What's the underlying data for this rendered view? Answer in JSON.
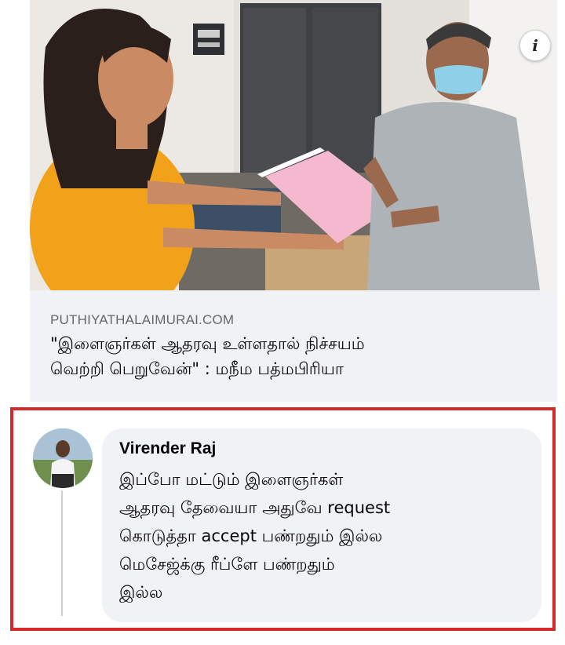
{
  "post": {
    "image_alt": "",
    "info_icon": "info-icon",
    "info_glyph": "i",
    "link_source": "PUTHIYATHALAIMURAI.COM",
    "headline_line1": "\"இளைஞர்கள் ஆதரவு உள்ளதால் நிச்சயம்",
    "headline_line2": "வெற்றி பெறுவேன்\" : மநீம பத்மபிரியா"
  },
  "comment": {
    "author": "Virender Raj",
    "lines": [
      "இப்போ மட்டும் இளைஞர்கள்",
      "ஆதரவு தேவையா அதுவே request",
      "கொடுத்தா accept பண்றதும் இல்ல",
      "மெசேஜ்க்கு ரீப்ளே பண்றதும்",
      "இல்ல"
    ],
    "highlight_color": "#d42a2a"
  }
}
